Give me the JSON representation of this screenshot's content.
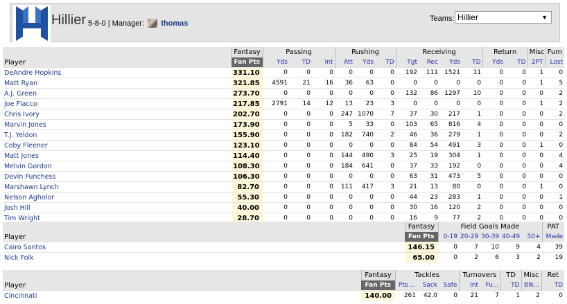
{
  "header": {
    "team_name": "Hillier",
    "record": "5-8-0 | Manager:",
    "manager": "thomas",
    "teams_label": "Teams:",
    "teams_selected": "Hillier",
    "colors": {
      "logo_blue": "#1f52a0"
    }
  },
  "offense": {
    "groups": [
      "Fantasy",
      "Passing",
      "Rushing",
      "Receiving",
      "Return",
      "Misc",
      "Fum"
    ],
    "columns": [
      "Player",
      "Fan Pts",
      "Yds",
      "TD",
      "Int",
      "Att",
      "Yds",
      "TD",
      "Tgt",
      "Rec",
      "Yds",
      "TD",
      "Yds",
      "TD",
      "2PT",
      "Lost"
    ],
    "rows": [
      {
        "name": "DeAndre Hopkins",
        "pts": "331.10",
        "s": [
          "0",
          "0",
          "0",
          "0",
          "0",
          "0",
          "192",
          "111",
          "1521",
          "11",
          "0",
          "0",
          "1",
          "0"
        ]
      },
      {
        "name": "Matt Ryan",
        "pts": "321.85",
        "s": [
          "4591",
          "21",
          "16",
          "36",
          "63",
          "0",
          "0",
          "0",
          "0",
          "0",
          "0",
          "0",
          "1",
          "5"
        ]
      },
      {
        "name": "A.J. Green",
        "pts": "273.70",
        "s": [
          "0",
          "0",
          "0",
          "0",
          "0",
          "0",
          "132",
          "86",
          "1297",
          "10",
          "0",
          "0",
          "0",
          "2"
        ]
      },
      {
        "name": "Joe Flacco",
        "pts": "217.85",
        "s": [
          "2791",
          "14",
          "12",
          "13",
          "23",
          "3",
          "0",
          "0",
          "0",
          "0",
          "0",
          "0",
          "1",
          "2"
        ]
      },
      {
        "name": "Chris Ivory",
        "pts": "202.70",
        "s": [
          "0",
          "0",
          "0",
          "247",
          "1070",
          "7",
          "37",
          "30",
          "217",
          "1",
          "0",
          "0",
          "0",
          "2"
        ]
      },
      {
        "name": "Marvin Jones",
        "pts": "173.90",
        "s": [
          "0",
          "0",
          "0",
          "5",
          "33",
          "0",
          "103",
          "65",
          "816",
          "4",
          "0",
          "0",
          "0",
          "0"
        ]
      },
      {
        "name": "T.J. Yeldon",
        "pts": "155.90",
        "s": [
          "0",
          "0",
          "0",
          "182",
          "740",
          "2",
          "46",
          "36",
          "279",
          "1",
          "0",
          "0",
          "0",
          "2"
        ]
      },
      {
        "name": "Coby Fleener",
        "pts": "123.10",
        "s": [
          "0",
          "0",
          "0",
          "0",
          "0",
          "0",
          "84",
          "54",
          "491",
          "3",
          "0",
          "0",
          "1",
          "0"
        ]
      },
      {
        "name": "Matt Jones",
        "pts": "114.40",
        "s": [
          "0",
          "0",
          "0",
          "144",
          "490",
          "3",
          "25",
          "19",
          "304",
          "1",
          "0",
          "0",
          "0",
          "4"
        ]
      },
      {
        "name": "Melvin Gordon",
        "pts": "108.30",
        "s": [
          "0",
          "0",
          "0",
          "184",
          "641",
          "0",
          "37",
          "33",
          "192",
          "0",
          "0",
          "0",
          "0",
          "4"
        ]
      },
      {
        "name": "Devin Funchess",
        "pts": "106.30",
        "s": [
          "0",
          "0",
          "0",
          "0",
          "0",
          "0",
          "63",
          "31",
          "473",
          "5",
          "0",
          "0",
          "0",
          "0"
        ]
      },
      {
        "name": "Marshawn Lynch",
        "pts": "82.70",
        "s": [
          "0",
          "0",
          "0",
          "111",
          "417",
          "3",
          "21",
          "13",
          "80",
          "0",
          "0",
          "0",
          "1",
          "0"
        ]
      },
      {
        "name": "Nelson Agholor",
        "pts": "55.30",
        "s": [
          "0",
          "0",
          "0",
          "0",
          "0",
          "0",
          "44",
          "23",
          "283",
          "1",
          "0",
          "0",
          "0",
          "1"
        ]
      },
      {
        "name": "Josh Hill",
        "pts": "40.00",
        "s": [
          "0",
          "0",
          "0",
          "0",
          "0",
          "0",
          "30",
          "16",
          "120",
          "2",
          "0",
          "0",
          "0",
          "0"
        ]
      },
      {
        "name": "Tim Wright",
        "pts": "28.70",
        "s": [
          "0",
          "0",
          "0",
          "0",
          "0",
          "0",
          "16",
          "9",
          "77",
          "2",
          "0",
          "0",
          "0",
          "0"
        ]
      }
    ]
  },
  "kickers": {
    "groups": [
      "Fantasy",
      "Field Goals Made",
      "PAT"
    ],
    "columns": [
      "Player",
      "Fan Pts",
      "0-19",
      "20-29",
      "30-39",
      "40-49",
      "50+",
      "Made"
    ],
    "rows": [
      {
        "name": "Cairo Santos",
        "pts": "146.15",
        "s": [
          "0",
          "7",
          "10",
          "9",
          "4",
          "39"
        ]
      },
      {
        "name": "Nick Folk",
        "pts": "65.00",
        "s": [
          "0",
          "2",
          "6",
          "3",
          "2",
          "19"
        ]
      }
    ]
  },
  "defense": {
    "groups": [
      "Fantasy",
      "Tackles",
      "Turnovers",
      "TD",
      "Misc",
      "Ret"
    ],
    "columns": [
      "Player",
      "Fan Pts",
      "Pts ...",
      "Sack",
      "Safe",
      "Int",
      "Fu...",
      "TD",
      "Blk...",
      "TD"
    ],
    "rows": [
      {
        "name": "Cincinnati",
        "pts": "140.00",
        "s": [
          "261",
          "42.0",
          "0",
          "21",
          "7",
          "1",
          "2",
          "0"
        ]
      }
    ]
  }
}
